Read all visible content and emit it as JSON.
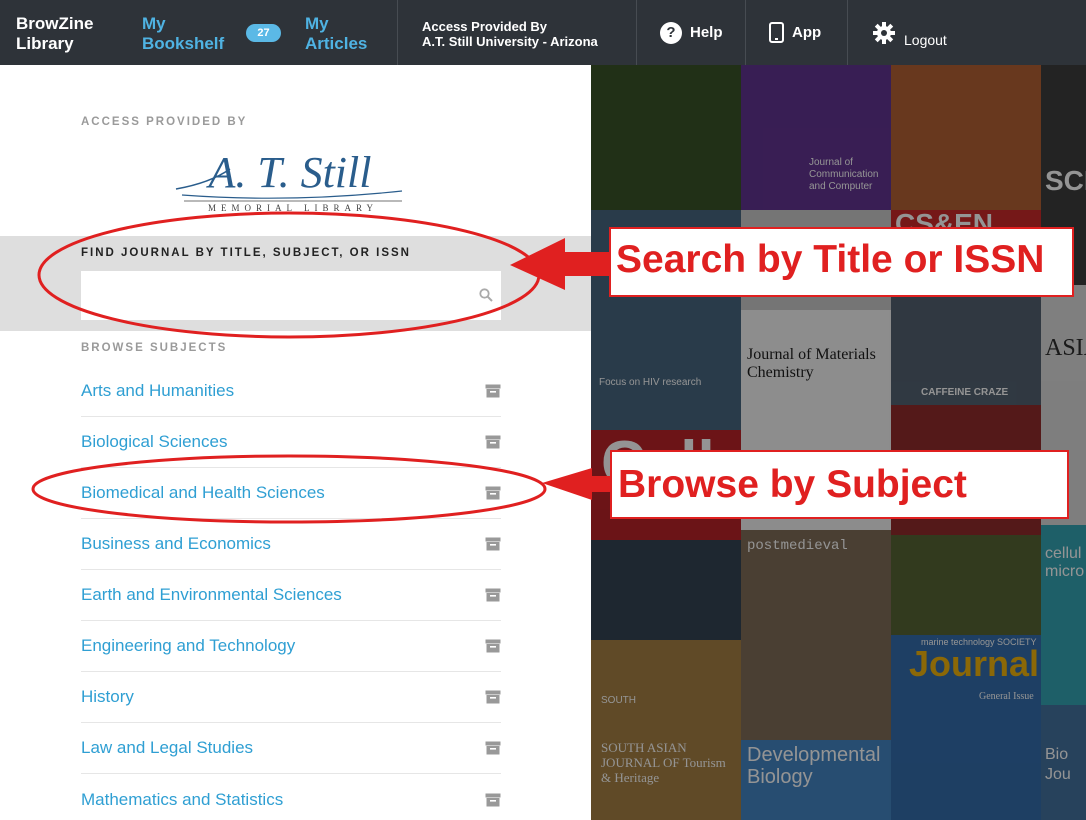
{
  "nav": {
    "brand_line1": "BrowZine",
    "brand_line2": "Library",
    "bookshelf_line1": "My",
    "bookshelf_line2": "Bookshelf",
    "bookshelf_count": "27",
    "articles_line1": "My",
    "articles_line2": "Articles",
    "access_line1": "Access Provided By",
    "access_line2": "A.T. Still University - Arizona",
    "help_label": "Help",
    "app_label": "App",
    "logout_label": "Logout"
  },
  "left": {
    "access_label": "ACCESS PROVIDED BY",
    "logo_text": "A. T. Still",
    "logo_subtext": "MEMORIAL LIBRARY",
    "search_label": "FIND JOURNAL BY TITLE, SUBJECT, OR ISSN",
    "search_value": "",
    "browse_label": "BROWSE SUBJECTS",
    "subjects": [
      "Arts and Humanities",
      "Biological Sciences",
      "Biomedical and Health Sciences",
      "Business and Economics",
      "Earth and Environmental Sciences",
      "Engineering and Technology",
      "History",
      "Law and Legal Studies",
      "Mathematics and Statistics"
    ]
  },
  "covers": {
    "c1": "Journal of Communication and Computer",
    "c2": "Journal of Materials Chemistry",
    "c3": "CAFFEINE CRAZE",
    "c4": "Cell",
    "c5": "postmedieval",
    "c6": "Journal",
    "c6b": "General Issue",
    "c7": "Developmental Biology",
    "c8": "SOUTH ASIAN JOURNAL OF Tourism & Heritage",
    "c9": "cellul micro",
    "c10": "Bio Jou",
    "c11": "CS&EN",
    "c12": "Focus on HIV research",
    "c13": "SOUTH",
    "c14": "SCI",
    "c15": "ASIA",
    "c16": "marine technology SOCIETY"
  },
  "annotations": {
    "search_callout": "Search by Title or ISSN",
    "browse_callout": "Browse by Subject",
    "annotation_color": "#e02020"
  },
  "colors": {
    "topbar": "#2e3339",
    "link": "#2f9fd3",
    "badge": "#5bb9e6"
  }
}
